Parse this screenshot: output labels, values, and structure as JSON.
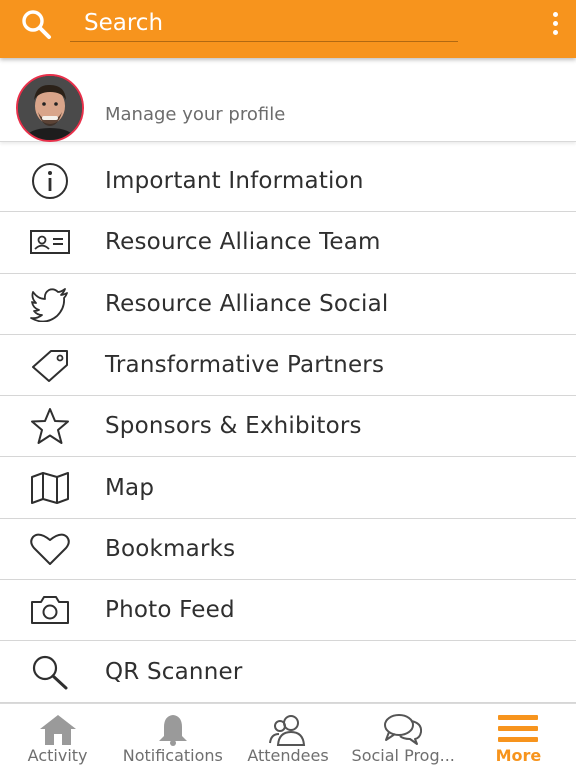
{
  "header": {
    "search_placeholder": "Search",
    "search_icon": "search-icon",
    "more_options_icon": "kebab-menu-icon",
    "accent_color": "#f7941d"
  },
  "profile": {
    "manage_label": "Manage your profile"
  },
  "menu": {
    "items": [
      {
        "label": "Important Information",
        "icon": "info-icon"
      },
      {
        "label": "Resource Alliance Team",
        "icon": "id-card-icon"
      },
      {
        "label": "Resource Alliance Social",
        "icon": "twitter-bird-icon"
      },
      {
        "label": "Transformative Partners",
        "icon": "tag-icon"
      },
      {
        "label": "Sponsors & Exhibitors",
        "icon": "star-icon"
      },
      {
        "label": "Map",
        "icon": "map-icon"
      },
      {
        "label": "Bookmarks",
        "icon": "heart-icon"
      },
      {
        "label": "Photo Feed",
        "icon": "camera-icon"
      },
      {
        "label": "QR Scanner",
        "icon": "magnifier-icon"
      }
    ]
  },
  "tabbar": {
    "tabs": [
      {
        "label": "Activity",
        "icon": "home-icon",
        "active": false
      },
      {
        "label": "Notifications",
        "icon": "bell-icon",
        "active": false
      },
      {
        "label": "Attendees",
        "icon": "people-icon",
        "active": false
      },
      {
        "label": "Social Prog...",
        "icon": "chat-bubbles-icon",
        "active": false
      },
      {
        "label": "More",
        "icon": "hamburger-icon",
        "active": true
      }
    ],
    "active_color": "#f7941d",
    "inactive_color": "#6f6f6f"
  }
}
